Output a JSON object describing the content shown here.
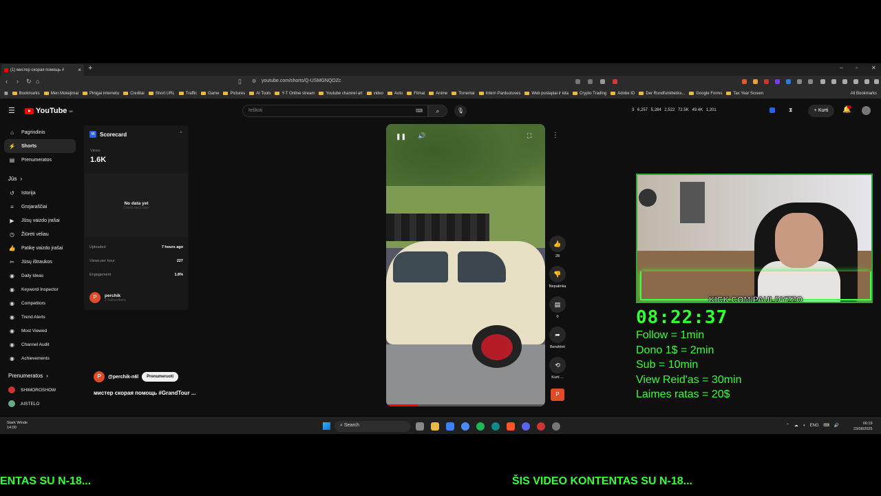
{
  "browser": {
    "tab_title": "(1) мистер скорая помощь #",
    "new_tab": "+",
    "url": "youtube.com/shorts/Q-USMGNQOZc",
    "bookmarks": [
      "Bookmarks",
      "Men.Mokejimai",
      "Pinigai internetu",
      "Creditai",
      "Short URL",
      "Traffic",
      "Game",
      "Pictures",
      "AI Tools",
      "Y-T Online stream",
      "Youtube channel art",
      "video",
      "Auto",
      "Filmai",
      "Anime",
      "Torrentai",
      "Intern Parduotuves",
      "Web puslapiai ir kita",
      "Crypto Trading",
      "Adobe ID",
      "Der Rundfunkbeitra...",
      "Google Forms",
      "Tax Year Screen"
    ],
    "all_bookmarks": "All Bookmarks"
  },
  "youtube": {
    "logo": "YouTube",
    "logo_region": "DE",
    "search_placeholder": "Ieškoti",
    "stats": "3   6,257   5,284   2,522   72.5K   49.4K   1,201",
    "create_label": "Kurti"
  },
  "sidebar": {
    "items": [
      {
        "label": "Pagrindinis",
        "icon": "home-icon"
      },
      {
        "label": "Shorts",
        "icon": "shorts-icon"
      },
      {
        "label": "Prenumeratos",
        "icon": "subscriptions-icon"
      }
    ],
    "you_heading": "Jūs",
    "you_items": [
      {
        "label": "Istorija",
        "icon": "history-icon"
      },
      {
        "label": "Grojaraščiai",
        "icon": "playlists-icon"
      },
      {
        "label": "Jūsų vaizdo įrašai",
        "icon": "your-videos-icon"
      },
      {
        "label": "Žiūrėti vėliau",
        "icon": "watch-later-icon"
      },
      {
        "label": "Patikę vaizdo įrašai",
        "icon": "liked-icon"
      },
      {
        "label": "Jūsų ištraukos",
        "icon": "clips-icon"
      }
    ],
    "tools": [
      "Daily Ideas",
      "Keyword Inspector",
      "Competitors",
      "Trend Alerts",
      "Most Viewed",
      "Channel Audit",
      "Achievements"
    ],
    "subs_heading": "Prenumeratos",
    "subs": [
      "SHIMOROSHOW",
      "AISTELO"
    ]
  },
  "scorecard": {
    "title": "Scorecard",
    "views_label": "Views",
    "views_value": "1.6K",
    "no_data": "No data yet",
    "no_data_sub": "Check back later",
    "rows": [
      {
        "label": "Uploaded",
        "value": "7 hours ago"
      },
      {
        "label": "Views per hour",
        "value": "227"
      },
      {
        "label": "Engagement",
        "value": "1.8%"
      }
    ],
    "channel_initial": "P",
    "channel_name": "perchik",
    "channel_subs": "2 Subscribers"
  },
  "short": {
    "progress": 0.2,
    "actions": [
      {
        "label": "28",
        "icon": "like-icon",
        "glyph": "👍"
      },
      {
        "label": "Nepatinka",
        "icon": "dislike-icon",
        "glyph": "👎"
      },
      {
        "label": "0",
        "icon": "comments-icon",
        "glyph": "▤"
      },
      {
        "label": "Bendrinti",
        "icon": "share-icon",
        "glyph": "➦"
      },
      {
        "label": "Kurti ...",
        "icon": "remix-icon",
        "glyph": "⟲"
      }
    ],
    "channel_handle": "@perchik-n6l",
    "subscribe_label": "Prenumeruoti",
    "title": "мистер скорая помощь #GrandTour ..."
  },
  "stream": {
    "cam_text": "KICK.COM/PAULDYZZO",
    "timer": "08:22:37",
    "rules": [
      "Follow = 1min",
      "Dono 1$ = 2min",
      "Sub = 10min",
      "View Reid'as = 30min",
      "Laimes ratas = 20$"
    ],
    "ticker_left": "ENTAS SU N-18...",
    "ticker_right": "ŠIS VIDEO KONTENTAS SU N-18..."
  },
  "taskbar": {
    "weather_line1": "Stark Winde",
    "weather_line2": "14:00",
    "search_label": "Search",
    "lang": "ENG",
    "time": "06:19",
    "date": "23/08/2025"
  }
}
